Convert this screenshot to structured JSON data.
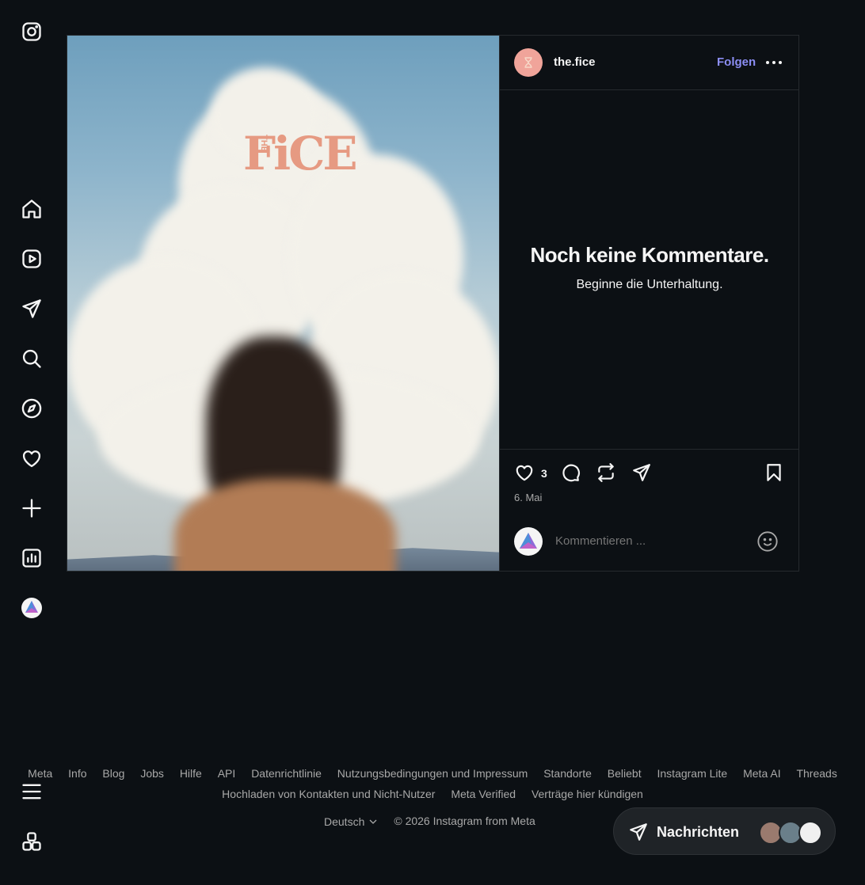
{
  "sidebar": {
    "items": [
      {
        "name": "instagram-logo-icon"
      },
      {
        "name": "home-icon"
      },
      {
        "name": "reels-icon"
      },
      {
        "name": "messages-icon"
      },
      {
        "name": "search-icon"
      },
      {
        "name": "explore-icon"
      },
      {
        "name": "notifications-heart-icon"
      },
      {
        "name": "create-plus-icon"
      },
      {
        "name": "dashboard-icon"
      },
      {
        "name": "profile-avatar"
      },
      {
        "name": "menu-hamburger-icon"
      },
      {
        "name": "more-apps-icon"
      }
    ]
  },
  "post": {
    "media_brand_text": "FiCE",
    "media_brand_small": "THE",
    "username": "the.fice",
    "follow_label": "Folgen",
    "empty_title": "Noch keine Kommentare.",
    "empty_subtitle": "Beginne die Unterhaltung.",
    "like_count": "3",
    "date": "6. Mai",
    "comment_placeholder": "Kommentieren ..."
  },
  "footer": {
    "links": [
      "Meta",
      "Info",
      "Blog",
      "Jobs",
      "Hilfe",
      "API",
      "Datenrichtlinie",
      "Nutzungsbedingungen und Impressum",
      "Standorte",
      "Beliebt",
      "Instagram Lite",
      "Meta AI",
      "Threads",
      "Hochladen von Kontakten und Nicht-Nutzer",
      "Meta Verified",
      "Verträge hier kündigen"
    ],
    "language": "Deutsch",
    "copyright": "© 2026 Instagram from Meta"
  },
  "messages_button": {
    "label": "Nachrichten"
  },
  "colors": {
    "background": "#0c1014",
    "accent_link": "#8c8ef5",
    "muted_text": "#a8a8a8"
  }
}
